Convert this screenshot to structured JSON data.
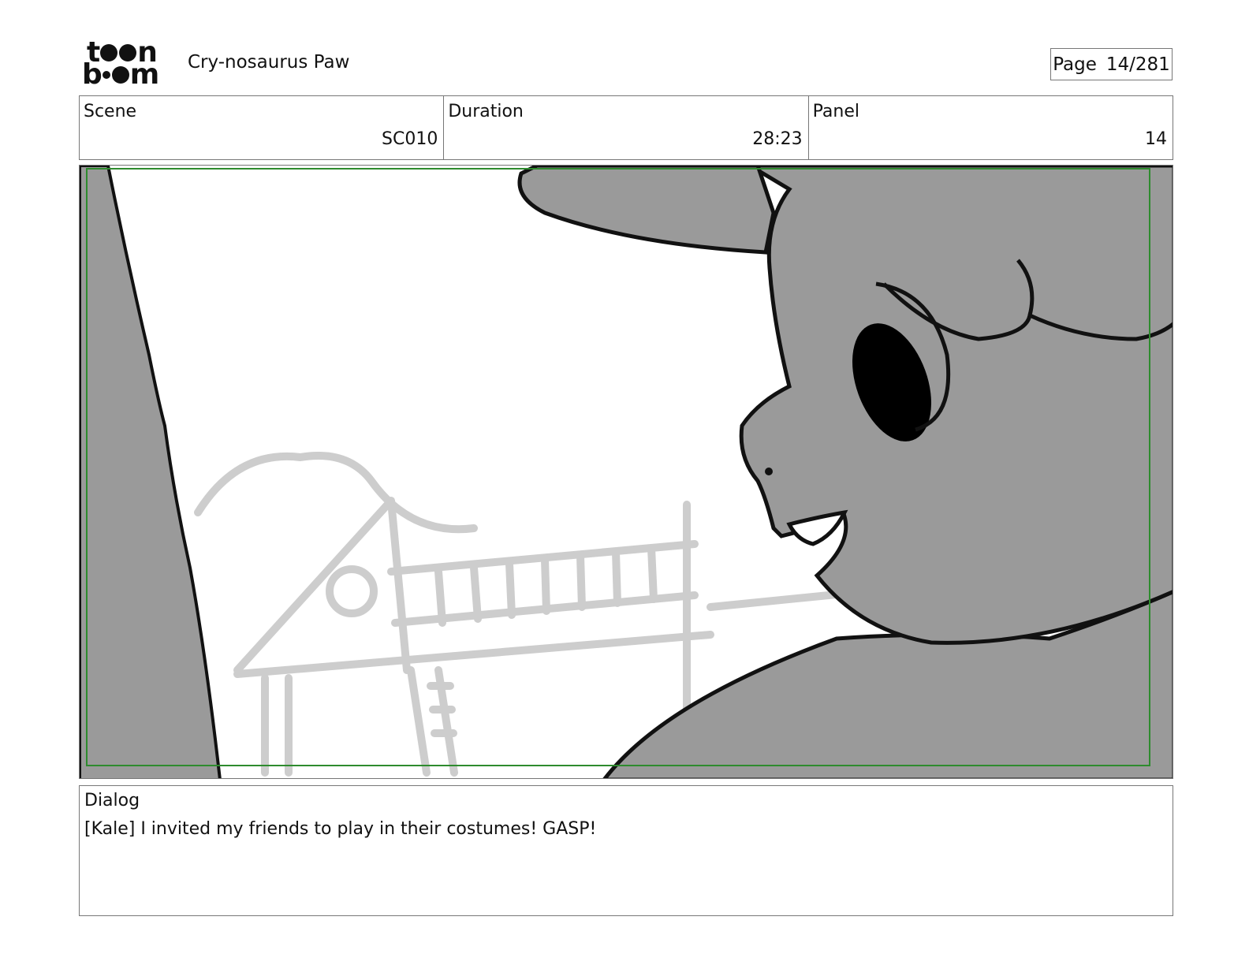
{
  "header": {
    "logo": {
      "line1": "toon",
      "line2": "boom",
      "icon": "toon-boom-logo"
    },
    "project_title": "Cry-nosaurus Paw",
    "page": {
      "label": "Page",
      "value": "14/281"
    }
  },
  "info": {
    "scene": {
      "label": "Scene",
      "value": "SC010"
    },
    "duration": {
      "label": "Duration",
      "value": "28:23"
    },
    "panel": {
      "label": "Panel",
      "value": "14"
    }
  },
  "panel_image": {
    "description_icon": "storyboard-drawing",
    "colors": {
      "fill": "#9a9a9a",
      "line": "#111111",
      "safe_frame": "#2e8b2e",
      "background_sketch": "#c8c8c8"
    }
  },
  "dialog": {
    "label": "Dialog",
    "text": "[Kale] I invited my friends to play in their costumes! GASP!"
  }
}
